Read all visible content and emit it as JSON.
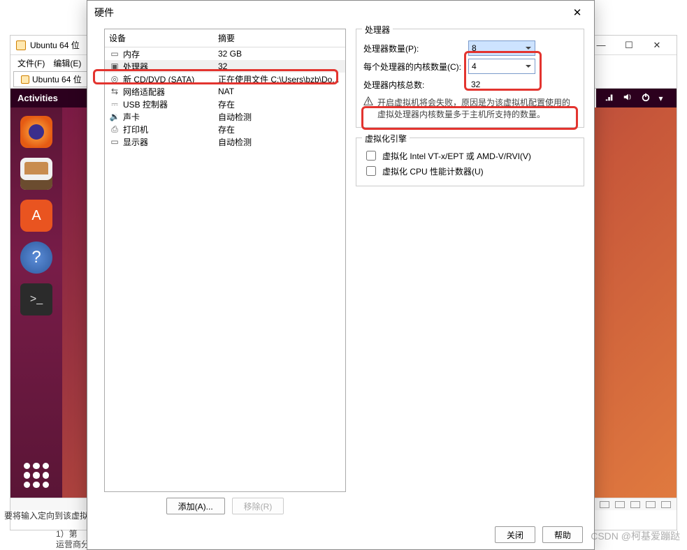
{
  "bg": {
    "title": "Ubuntu 64 位",
    "menu": {
      "file": "文件(F)",
      "edit": "编辑(E)"
    },
    "tab": "Ubuntu 64 位",
    "activities": "Activities",
    "status_hint": "要将输入定向到该虚拟",
    "footer_l1": "1）第",
    "footer_l2": "运营商分配"
  },
  "dialog": {
    "title": "硬件",
    "headers": {
      "device": "设备",
      "summary": "摘要"
    },
    "rows": [
      {
        "icon": "mem",
        "name": "内存",
        "summary": "32 GB"
      },
      {
        "icon": "cpu",
        "name": "处理器",
        "summary": "32",
        "selected": true
      },
      {
        "icon": "cd",
        "name": "新 CD/DVD (SATA)",
        "summary": "正在使用文件 C:\\Users\\bzb\\Do..."
      },
      {
        "icon": "net",
        "name": "网络适配器",
        "summary": "NAT"
      },
      {
        "icon": "usb",
        "name": "USB 控制器",
        "summary": "存在"
      },
      {
        "icon": "snd",
        "name": "声卡",
        "summary": "自动检测"
      },
      {
        "icon": "prn",
        "name": "打印机",
        "summary": "存在"
      },
      {
        "icon": "dsp",
        "name": "显示器",
        "summary": "自动检测"
      }
    ],
    "add": "添加(A)...",
    "remove": "移除(R)",
    "proc": {
      "group": "处理器",
      "count_label": "处理器数量(P):",
      "cores_label": "每个处理器的内核数量(C):",
      "total_label": "处理器内核总数:",
      "count_value": "8",
      "cores_value": "4",
      "total_value": "32",
      "warning": "开启虚拟机将会失败，原因是为该虚拟机配置使用的虚拟处理器内核数量多于主机所支持的数量。"
    },
    "virt": {
      "group": "虚拟化引擎",
      "vt": "虚拟化 Intel VT-x/EPT 或 AMD-V/RVI(V)",
      "perf": "虚拟化 CPU 性能计数器(U)"
    },
    "close": "关闭",
    "help": "帮助"
  },
  "watermark": "CSDN @柯基爱蹦跶"
}
